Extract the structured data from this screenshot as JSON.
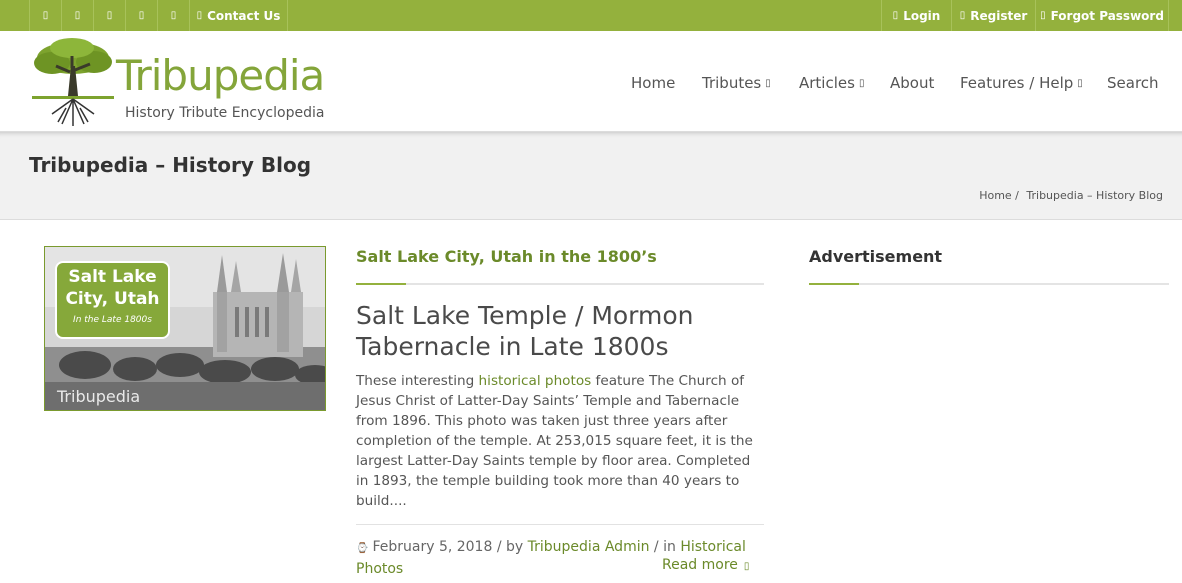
{
  "topbar": {
    "social_icons": [
      "facebook-icon",
      "twitter-icon",
      "instagram-icon",
      "pinterest-icon",
      "youtube-icon"
    ],
    "icon_glyph": "▯",
    "contact": "Contact Us",
    "login": "Login",
    "register": "Register",
    "forgot": "Forgot Password"
  },
  "logo": {
    "title": "Tribupedia",
    "subtitle": "History Tribute Encyclopedia"
  },
  "nav": {
    "home": "Home",
    "tributes": "Tributes",
    "articles": "Articles",
    "about": "About",
    "features": "Features / Help",
    "search": "Search",
    "caret": "▯"
  },
  "band": {
    "title": "Tribupedia – History Blog",
    "crumb_home": "Home /",
    "crumb_current": "Tribupedia – History Blog"
  },
  "thumbnail": {
    "badge_line1": "Salt Lake",
    "badge_line2": "City, Utah",
    "badge_line3": "In the Late 1800s",
    "watermark": "Tribupedia"
  },
  "post": {
    "category": "Salt Lake City, Utah in the 1800’s",
    "title": "Salt Lake Temple / Mormon Tabernacle in Late 1800s",
    "excerpt_before": "These interesting ",
    "excerpt_link": "historical photos",
    "excerpt_after": " feature The Church of Jesus Christ of Latter-Day Saints’ Temple and Tabernacle from 1896. This photo was taken just three years after completion of the temple. At 253,015 square feet, it is the largest Latter-Day Saints temple by floor area. Completed in 1893, the temple building took more than 40 years to build....",
    "date": "February 5, 2018",
    "by": " / by ",
    "author": "Tribupedia Admin",
    "in": " / in ",
    "category_link": "Historical Photos",
    "read_more": "Read more",
    "clock_glyph": "⌚"
  },
  "sidebar": {
    "title": "Advertisement"
  },
  "colors": {
    "accent": "#94b13d",
    "link": "#6b8a2a"
  }
}
